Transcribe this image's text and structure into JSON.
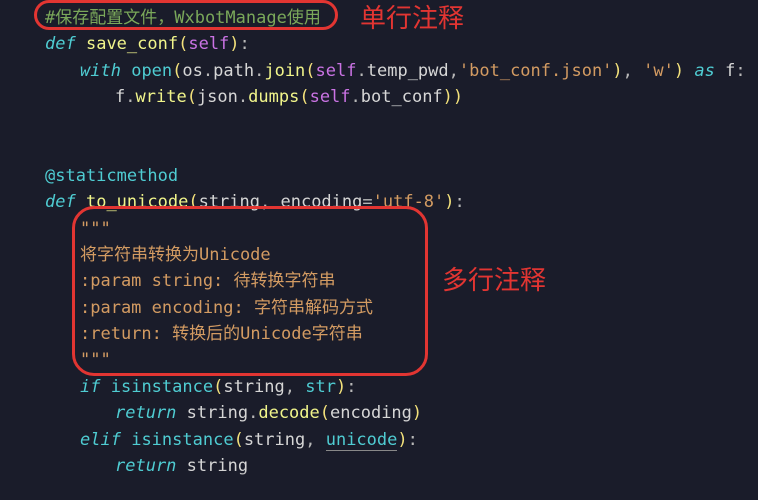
{
  "annotations": {
    "single_line": "单行注释",
    "multi_line": "多行注释"
  },
  "code": {
    "comment1": "#保存配置文件，WxbotManage使用",
    "def1": {
      "kw_def": "def",
      "name": "save_conf",
      "lp": "(",
      "self": "self",
      "rp": ")",
      "colon": ":"
    },
    "with_line": {
      "kw_with": "with",
      "open": "open",
      "lp1": "(",
      "os": "os",
      "dot1": ".",
      "path": "path",
      "dot2": ".",
      "join": "join",
      "lp2": "(",
      "self": "self",
      "dot3": ".",
      "temp_pwd": "temp_pwd",
      "comma1": ",",
      "str1": "'bot_conf.json'",
      "rp2": ")",
      "comma2": ", ",
      "str2": "'w'",
      "rp1": ")",
      "kw_as": " as ",
      "f": "f",
      "colon": ":"
    },
    "fwrite": {
      "f": "f",
      "dot1": ".",
      "write": "write",
      "lp1": "(",
      "json": "json",
      "dot2": ".",
      "dumps": "dumps",
      "lp2": "(",
      "self": "self",
      "dot3": ".",
      "bot_conf": "bot_conf",
      "rp2": ")",
      "rp1": ")"
    },
    "decorator": "@staticmethod",
    "def2": {
      "kw_def": "def",
      "name": "to_unicode",
      "lp": "(",
      "p1": "string",
      "comma": ", ",
      "p2": "encoding",
      "eq": "=",
      "default": "'utf-8'",
      "rp": ")",
      "colon": ":"
    },
    "doc_open": "\"\"\"",
    "doc1": "将字符串转换为Unicode",
    "doc2": ":param string: 待转换字符串",
    "doc3": ":param encoding: 字符串解码方式",
    "doc4": ":return: 转换后的Unicode字符串",
    "doc_close": "\"\"\"",
    "if_line": {
      "kw_if": "if",
      "isinstance": "isinstance",
      "lp": "(",
      "p1": "string",
      "comma": ", ",
      "p2": "str",
      "rp": ")",
      "colon": ":"
    },
    "ret1": {
      "kw_return": "return",
      "string": "string",
      "dot": ".",
      "decode": "decode",
      "lp": "(",
      "encoding": "encoding",
      "rp": ")"
    },
    "elif_line": {
      "kw_elif": "elif",
      "isinstance": "isinstance",
      "lp": "(",
      "p1": "string",
      "comma": ", ",
      "p2": "unicode",
      "rp": ")",
      "colon": ":"
    },
    "ret2": {
      "kw_return": "return",
      "string": "string"
    }
  }
}
